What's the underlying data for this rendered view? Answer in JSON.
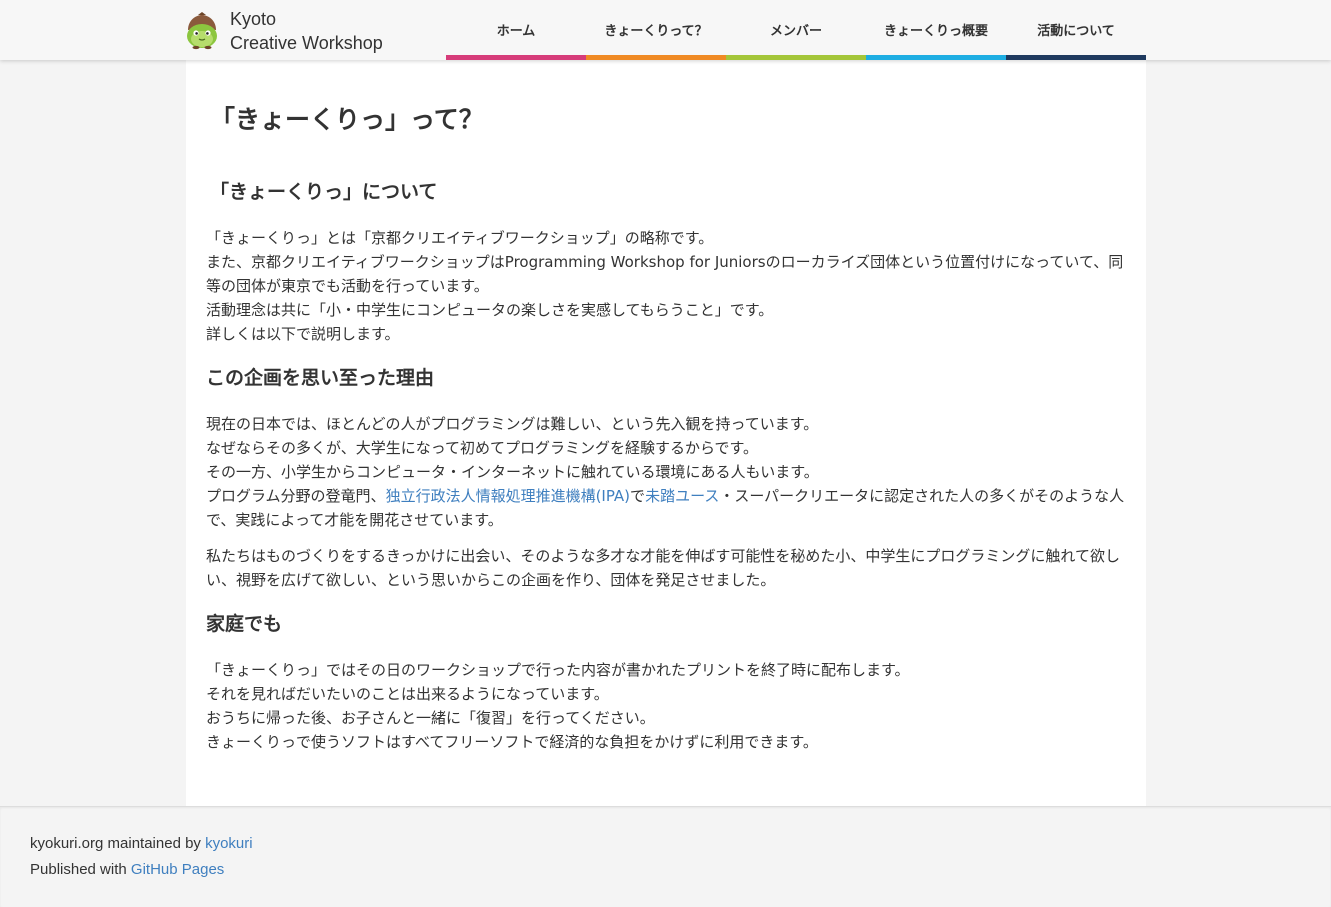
{
  "header": {
    "brand": {
      "line1": "Kyoto",
      "line2": "Creative Workshop",
      "logo_icon": "kyokuri-chestnut-mascot-icon"
    },
    "nav": [
      {
        "label": "ホーム",
        "color": "#d63c7a"
      },
      {
        "label": "きょーくりって？",
        "color": "#f08a24"
      },
      {
        "label": "メンバー",
        "color": "#a4c639"
      },
      {
        "label": "きょーくりっ概要",
        "color": "#1eaee3"
      },
      {
        "label": "活動について",
        "color": "#1f3a5f"
      }
    ]
  },
  "main": {
    "title": "「きょーくりっ」って？",
    "sections": {
      "about": {
        "heading": "「きょーくりっ」について",
        "lines": [
          "「きょーくりっ」とは「京都クリエイティブワークショップ」の略称です。",
          "また、京都クリエイティブワークショップはProgramming Workshop for Juniorsのローカライズ団体という位置付けになっていて、同等の団体が東京でも活動を行っています。",
          "活動理念は共に「小・中学生にコンピュータの楽しさを実感してもらうこと」です。",
          "詳しくは以下で説明します。"
        ]
      },
      "reason": {
        "heading": "この企画を思い至った理由",
        "lines": [
          "現在の日本では、ほとんどの人がプログラミングは難しい、という先入観を持っています。",
          "なぜならその多くが、大学生になって初めてプログラミングを経験するからです。",
          "その一方、小学生からコンピュータ・インターネットに触れている環境にある人もいます。"
        ],
        "ipa_line": {
          "prefix": "プログラム分野の登竜門、",
          "link1": "独立行政法人情報処理推進機構(IPA)",
          "middle": "で",
          "link2": "未踏ユース",
          "suffix": "・スーパークリエータに認定された人の多くがそのような人で、実践によって才能を開花させています。"
        },
        "paragraph2": "私たちはものづくりをするきっかけに出会い、そのような多才な才能を伸ばす可能性を秘めた小、中学生にプログラミングに触れて欲しい、視野を広げて欲しい、という思いからこの企画を作り、団体を発足させました。"
      },
      "home": {
        "heading": "家庭でも",
        "lines": [
          "「きょーくりっ」ではその日のワークショップで行った内容が書かれたプリントを終了時に配布します。",
          "それを見ればだいたいのことは出来るようになっています。",
          "おうちに帰った後、お子さんと一緒に「復習」を行ってください。",
          "きょーくりっで使うソフトはすべてフリーソフトで経済的な負担をかけずに利用できます。"
        ]
      }
    }
  },
  "footer": {
    "maintained_prefix": "kyokuri.org maintained by ",
    "maintained_link": "kyokuri",
    "published_prefix": "Published with ",
    "published_link": "GitHub Pages"
  },
  "colors": {
    "link": "#3f7fbf",
    "text": "#333333",
    "background": "#f4f4f4",
    "card": "#ffffff"
  }
}
